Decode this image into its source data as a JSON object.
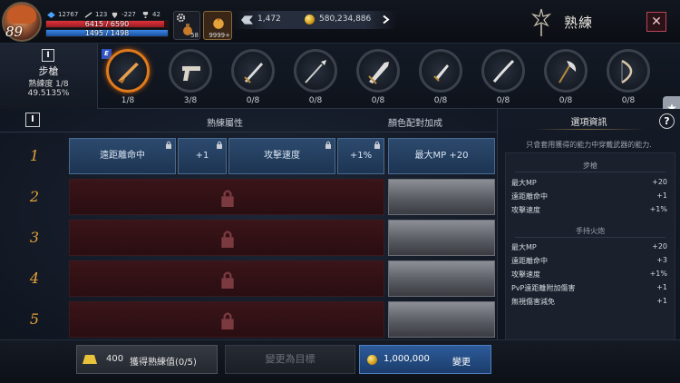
{
  "player": {
    "level": "89",
    "stat1": "12767",
    "stat2": "123",
    "stat3": "-227",
    "stat4": "42",
    "hp": "6415 / 6590",
    "hp_fraction": 0.973,
    "mp": "1495 / 1498",
    "mp_fraction": 0.998
  },
  "items": {
    "slot1_count": "58",
    "slot2_count": "9999+"
  },
  "currency": {
    "gems": "1,472",
    "gold": "580,234,886"
  },
  "header": {
    "title": "熟練",
    "close": "✕"
  },
  "selected_weapon": {
    "icon_label": "I",
    "name": "步槍",
    "proficiency": "熟練度 1/8",
    "percent": "49.5135%"
  },
  "e_badge": "E",
  "weapons": [
    {
      "type": "rifle",
      "count": "1/8",
      "active": true
    },
    {
      "type": "pistol",
      "count": "3/8",
      "active": false
    },
    {
      "type": "sword",
      "count": "0/8",
      "active": false
    },
    {
      "type": "spear",
      "count": "0/8",
      "active": false
    },
    {
      "type": "greatsword",
      "count": "0/8",
      "active": false
    },
    {
      "type": "dagger",
      "count": "0/8",
      "active": false
    },
    {
      "type": "katana",
      "count": "0/8",
      "active": false
    },
    {
      "type": "axe",
      "count": "0/8",
      "active": false
    },
    {
      "type": "bow",
      "count": "0/8",
      "active": false
    }
  ],
  "table": {
    "header_icon": "I",
    "col_attr": "熟練屬性",
    "col_color": "顏色配對加成",
    "rows": [
      {
        "num": "1",
        "stat1": "遠距離命中",
        "stat1_val": "+1",
        "stat2": "攻擊速度",
        "stat2_val": "+1%",
        "color_bonus": "最大MP +20",
        "locked": false
      },
      {
        "num": "2",
        "locked": true
      },
      {
        "num": "3",
        "locked": true
      },
      {
        "num": "4",
        "locked": true
      },
      {
        "num": "5",
        "locked": true
      }
    ]
  },
  "right_panel": {
    "title": "選項資訊",
    "help": "?",
    "desc": "只會套用獲得的能力中穿戴武器的能力.",
    "section1": {
      "title": "步槍",
      "stats": [
        {
          "name": "最大MP",
          "val": "+20"
        },
        {
          "name": "遠距離命中",
          "val": "+1"
        },
        {
          "name": "攻擊速度",
          "val": "+1%"
        }
      ]
    },
    "section2": {
      "title": "手持火炮",
      "stats": [
        {
          "name": "最大MP",
          "val": "+20"
        },
        {
          "name": "遠距離命中",
          "val": "+3"
        },
        {
          "name": "攻擊速度",
          "val": "+1%"
        },
        {
          "name": "PvP遠距離附加傷害",
          "val": "+1"
        },
        {
          "name": "無視傷害減免",
          "val": "+1"
        }
      ]
    }
  },
  "bottom": {
    "gain_cost": "400",
    "gain_label": "獲得熟練值(0/5)",
    "target_label": "變更為目標",
    "change_cost": "1,000,000",
    "change_label": "變更"
  },
  "colors": {
    "accent_orange": "#e07a1a",
    "row_blue": "#2c4a6e",
    "locked_red": "#3a1418",
    "row_number": "#e2a23b",
    "change_button": "#2d5b9a"
  }
}
